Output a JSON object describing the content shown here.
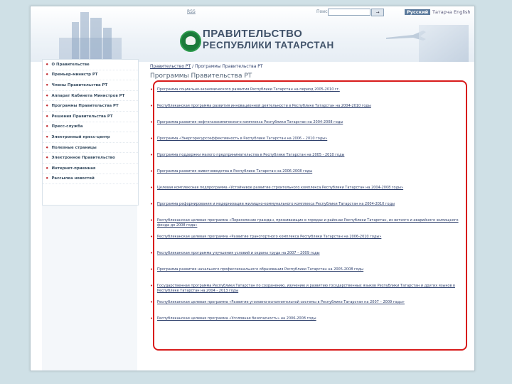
{
  "header": {
    "title_line1": "ПРАВИТЕЛЬСТВО",
    "title_line2": "РЕСПУБЛИКИ ТАТАРСТАН",
    "rss": "RSS",
    "search_label": "Поиск",
    "search_button": "→",
    "languages": [
      "Русский",
      "Татарча",
      "English"
    ]
  },
  "sidebar": {
    "items": [
      {
        "label": "О Правительстве"
      },
      {
        "label": "Премьер-министр РТ"
      },
      {
        "label": "Члены Правительства РТ"
      },
      {
        "label": "Аппарат Кабинета Министров РТ"
      },
      {
        "label": "Программы Правительства РТ"
      },
      {
        "label": "Решения Правительства РТ"
      },
      {
        "label": "Пресс-служба"
      },
      {
        "label": "Электронный пресс-центр"
      },
      {
        "label": "Полезные страницы"
      },
      {
        "label": "Электронное Правительство"
      },
      {
        "label": "Интернет-приемная"
      },
      {
        "label": "Рассылка новостей"
      }
    ]
  },
  "breadcrumb": {
    "home": "Правительство РТ",
    "separator": "/",
    "current": "Программы Правительства РТ"
  },
  "page_title": "Программы Правительства РТ",
  "programs": [
    {
      "text": "Программа социально-экономического развития Республики Татарстан на период 2005-2010 гг."
    },
    {
      "text": "Республиканская программа развития инновационной деятельности в Республике Татарстан на 2004-2010 годы"
    },
    {
      "text": "Программа развития нефтегазохимического комплекса Республики Татарстан на 2004-2008 годы"
    },
    {
      "text": "Программа «Энергоресурсоэффективность в Республике Татарстан на 2006 – 2010 годы»"
    },
    {
      "text": "Программа поддержки малого предпринимательства в Республике Татарстан на 2005 - 2010 годы"
    },
    {
      "text": "Программа развития животноводства в Республике Татарстан на 2006-2008 годы"
    },
    {
      "text": "Целевая комплексная подпрограмма «Устойчивое развитие строительного комплекса Республики Татарстан на 2004-2008 годы»"
    },
    {
      "text": "Программа реформирования и модернизации жилищно-коммунального комплекса Республики Татарстан на 2004-2010 годы"
    },
    {
      "text": "Республиканская целевая программа «Переселение граждан, проживающих в городах и районах Республики Татарстан, из ветхого и аварийного жилищного фонда до 2008 года»"
    },
    {
      "text": "Республиканская целевая программа «Развитие транспортного комплекса Республики Татарстан на 2006-2010 годы»"
    },
    {
      "text": "Республиканская программа улучшения условий и охраны труда на 2007 – 2009 годы"
    },
    {
      "text": "Программа развития начального профессионального образования Республики Татарстан на 2005-2008 годы"
    },
    {
      "text": "Государственная программа Республики Татарстан по сохранению, изучению и развитию государственных языков Республики Татарстан и других языков в Республике Татарстан на 2004 - 2013 годы"
    },
    {
      "text": "Республиканская целевая программа «Развитие уголовно-исполнительной системы в Республике Татарстан на 2007 – 2009 годы»"
    },
    {
      "text": "Республиканская целевая программа «Уголовная безопасность» на 2006-2008 годы"
    }
  ]
}
